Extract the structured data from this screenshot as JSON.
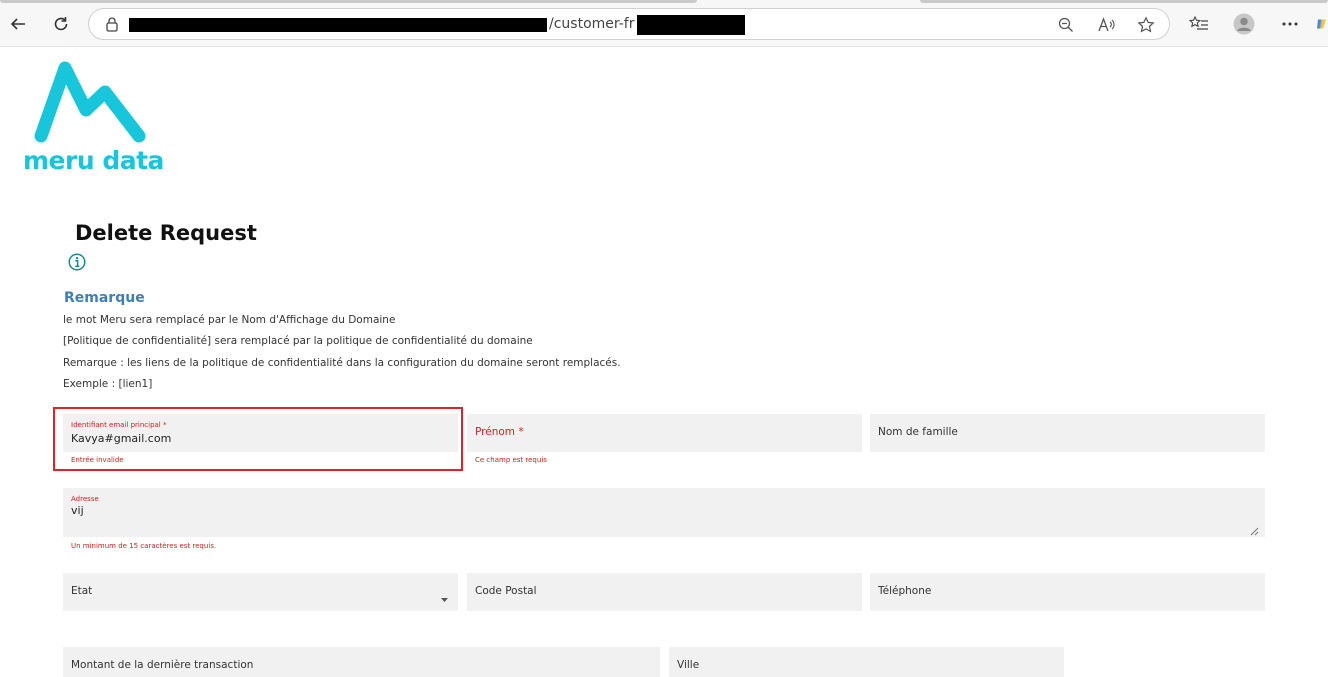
{
  "browser": {
    "url_visible": "/customer-fr",
    "back_icon": "back-arrow-icon",
    "refresh_icon": "refresh-icon",
    "lock_icon": "lock-icon",
    "zoom_icon": "zoom-out-icon",
    "read_aloud_icon": "read-aloud-icon",
    "favorite_icon": "star-icon",
    "favorites_list_icon": "favorites-list-icon",
    "profile_icon": "profile-avatar-icon",
    "menu_icon": "more-options-icon"
  },
  "brand": {
    "logo_text": "meru data",
    "logo_color": "#18c6dc"
  },
  "page": {
    "title": "Delete Request",
    "info_icon": "info-icon"
  },
  "remarque": {
    "heading": "Remarque",
    "lines": [
      "le mot Meru sera remplacé par le Nom d'Affichage du Domaine",
      "[Politique de confidentialité] sera remplacé par la politique de confidentialité du domaine",
      "Remarque : les liens de la politique de confidentialité dans la configuration du domaine seront remplacés.",
      "Exemple : [lien1]"
    ]
  },
  "form": {
    "email": {
      "label": "Identifiant email principal *",
      "value": "Kavya#gmail.com",
      "error": "Entrée invalide"
    },
    "prenom": {
      "label": "Prénom *",
      "error": "Ce champ est requis"
    },
    "nom": {
      "label": "Nom de famille"
    },
    "adresse": {
      "label": "Adresse",
      "value": "vij",
      "error": "Un minimum de 15 caractères est requis."
    },
    "etat": {
      "label": "Etat"
    },
    "code_postal": {
      "label": "Code Postal"
    },
    "telephone": {
      "label": "Téléphone"
    },
    "montant": {
      "label": "Montant de la dernière transaction"
    },
    "ville": {
      "label": "Ville"
    }
  },
  "colors": {
    "error": "#d0211f",
    "heading_blue": "#3f7fb5",
    "field_bg": "#f1f1f1",
    "highlight_border": "#e0222a"
  }
}
